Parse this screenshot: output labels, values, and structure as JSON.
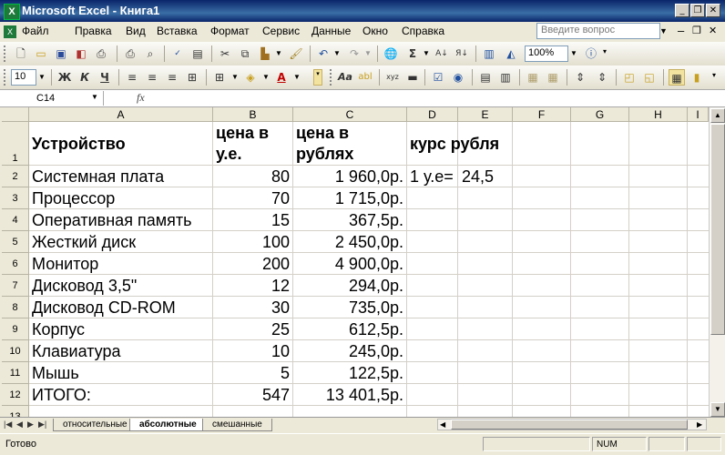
{
  "window": {
    "title": "Microsoft Excel - Книга1",
    "minimize": "_",
    "restore": "❐",
    "close": "✕"
  },
  "menu": {
    "items": [
      "Файл",
      "Правка",
      "Вид",
      "Вставка",
      "Формат",
      "Сервис",
      "Данные",
      "Окно",
      "Справка"
    ],
    "help_placeholder": "Введите вопрос",
    "doc_min": "–",
    "doc_restore": "❐",
    "doc_close": "✕"
  },
  "toolbar": {
    "zoom": "100%",
    "font_size": "10",
    "bold": "Ж",
    "italic": "К",
    "underline": "Ч"
  },
  "formula_bar": {
    "name_box": "C14",
    "fx": "fx",
    "formula": ""
  },
  "columns": [
    "A",
    "B",
    "C",
    "D",
    "E",
    "F",
    "G",
    "H",
    "I"
  ],
  "row_numbers": [
    "1",
    "2",
    "3",
    "4",
    "5",
    "6",
    "7",
    "8",
    "9",
    "10",
    "11",
    "12",
    "13"
  ],
  "sheet": {
    "headers": {
      "device": "Устройство",
      "price_ue": "цена в у.е.",
      "price_rub": "цена в рублях",
      "rate": "курс рубля"
    },
    "rate_label": "1 у.е=",
    "rate_value": "24,5",
    "rows": [
      {
        "name": "Системная плата",
        "ue": "80",
        "rub": "1 960,0р."
      },
      {
        "name": "Процессор",
        "ue": "70",
        "rub": "1 715,0р."
      },
      {
        "name": "Оперативная память",
        "ue": "15",
        "rub": "367,5р."
      },
      {
        "name": "Жесткий диск",
        "ue": "100",
        "rub": "2 450,0р."
      },
      {
        "name": "Монитор",
        "ue": "200",
        "rub": "4 900,0р."
      },
      {
        "name": "Дисковод 3,5\"",
        "ue": "12",
        "rub": "294,0р."
      },
      {
        "name": "Дисковод CD-ROM",
        "ue": "30",
        "rub": "735,0р."
      },
      {
        "name": "Корпус",
        "ue": "25",
        "rub": "612,5р."
      },
      {
        "name": "Клавиатура",
        "ue": "10",
        "rub": "245,0р."
      },
      {
        "name": "Мышь",
        "ue": "5",
        "rub": "122,5р."
      },
      {
        "name": "ИТОГО:",
        "ue": "547",
        "rub": "13 401,5р."
      }
    ]
  },
  "sheet_tabs": [
    "относительные",
    "абсолютные",
    "смешанные"
  ],
  "active_tab": "абсолютные",
  "status": {
    "text": "Готово",
    "num": "NUM"
  }
}
